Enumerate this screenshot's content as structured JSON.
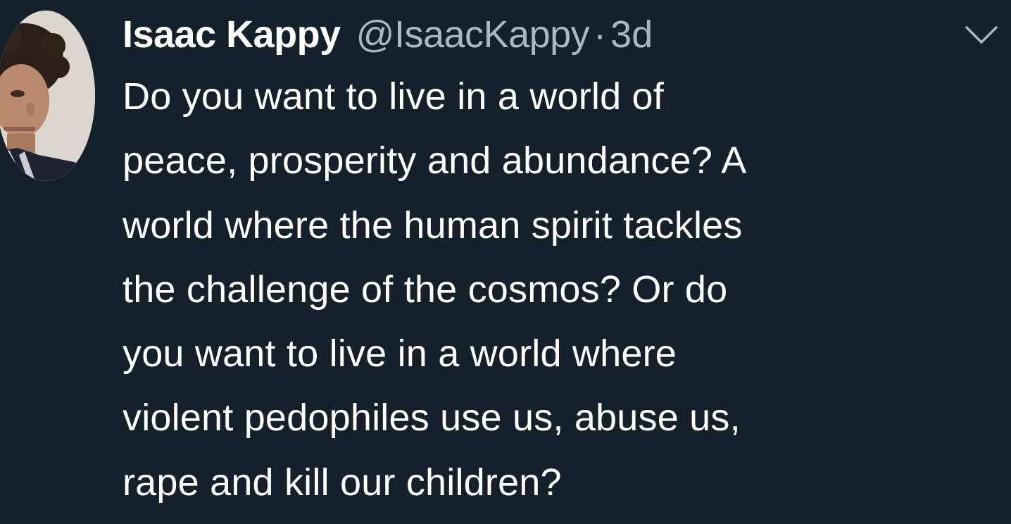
{
  "tweet": {
    "author": {
      "display_name": "Isaac Kappy",
      "handle": "@IsaacKappy",
      "avatar_icon": "profile-photo"
    },
    "separator": "·",
    "time_ago": "3d",
    "menu_icon": "chevron-down-icon",
    "text": "Do you want to live in a world of\npeace, prosperity and abundance? A\nworld where the human spirit tackles\nthe challenge of the cosmos? Or do\nyou want to live in a world where\nviolent pedophiles use us, abuse us,\nrape and kill our children?"
  },
  "colors": {
    "background": "#15202b",
    "primary_text": "#ffffff",
    "secondary_text": "#aab8c2"
  }
}
